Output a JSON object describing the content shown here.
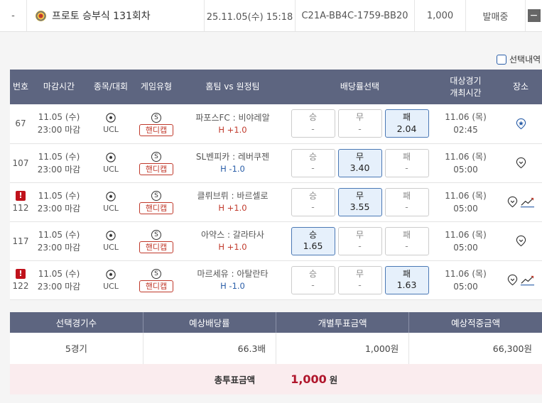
{
  "summary": {
    "dash": "-",
    "title": "프로토 승부식 131회차",
    "date": "25.11.05(수) 15:18",
    "code": "C21A-BB4C-1759-BB20",
    "amount": "1,000",
    "status": "발매중",
    "collapse": "−"
  },
  "select_label": "선택내역",
  "headers": {
    "no": "번호",
    "deadline": "마감시간",
    "sport": "종목/대회",
    "gtype": "게임유형",
    "teams": "홈팀 vs 원정팀",
    "odds": "배당률선택",
    "match_time_1": "대상경기",
    "match_time_2": "개최시간",
    "venue": "장소"
  },
  "games": [
    {
      "no": "67",
      "alert": false,
      "deadline_date": "11.05 (수)",
      "deadline_time": "23:00 마감",
      "league": "UCL",
      "gtype_s": "S",
      "gtype_badge": "핸디캡",
      "teams": "파포스FC : 비야레알",
      "handi": "H +1.0",
      "handi_sign": "plus",
      "odds": [
        {
          "label": "승",
          "value": "-",
          "selected": false
        },
        {
          "label": "무",
          "value": "-",
          "selected": false
        },
        {
          "label": "패",
          "value": "2.04",
          "selected": true
        }
      ],
      "match_date": "11.06 (목)",
      "match_time": "02:45",
      "venue_icon": "star-location-icon",
      "stats": false
    },
    {
      "no": "107",
      "alert": false,
      "deadline_date": "11.05 (수)",
      "deadline_time": "23:00 마감",
      "league": "UCL",
      "gtype_s": "S",
      "gtype_badge": "핸디캡",
      "teams": "SL벤피카 : 레버쿠젠",
      "handi": "H -1.0",
      "handi_sign": "minus",
      "odds": [
        {
          "label": "승",
          "value": "-",
          "selected": false
        },
        {
          "label": "무",
          "value": "3.40",
          "selected": true
        },
        {
          "label": "패",
          "value": "-",
          "selected": false
        }
      ],
      "match_date": "11.06 (목)",
      "match_time": "05:00",
      "venue_icon": "location-icon",
      "stats": false
    },
    {
      "no": "112",
      "alert": true,
      "alert_mark": "!",
      "deadline_date": "11.05 (수)",
      "deadline_time": "23:00 마감",
      "league": "UCL",
      "gtype_s": "S",
      "gtype_badge": "핸디캡",
      "teams": "클뤼브뤼 : 바르셀로",
      "handi": "H +1.0",
      "handi_sign": "plus",
      "odds": [
        {
          "label": "승",
          "value": "-",
          "selected": false
        },
        {
          "label": "무",
          "value": "3.55",
          "selected": true
        },
        {
          "label": "패",
          "value": "-",
          "selected": false
        }
      ],
      "match_date": "11.06 (목)",
      "match_time": "05:00",
      "venue_icon": "location-icon",
      "stats": true
    },
    {
      "no": "117",
      "alert": false,
      "deadline_date": "11.05 (수)",
      "deadline_time": "23:00 마감",
      "league": "UCL",
      "gtype_s": "S",
      "gtype_badge": "핸디캡",
      "teams": "아약스 : 갈라타사",
      "handi": "H +1.0",
      "handi_sign": "plus",
      "odds": [
        {
          "label": "승",
          "value": "1.65",
          "selected": true
        },
        {
          "label": "무",
          "value": "-",
          "selected": false
        },
        {
          "label": "패",
          "value": "-",
          "selected": false
        }
      ],
      "match_date": "11.06 (목)",
      "match_time": "05:00",
      "venue_icon": "location-icon",
      "stats": false
    },
    {
      "no": "122",
      "alert": true,
      "alert_mark": "!",
      "deadline_date": "11.05 (수)",
      "deadline_time": "23:00 마감",
      "league": "UCL",
      "gtype_s": "S",
      "gtype_badge": "핸디캡",
      "teams": "마르세유 : 아탈란타",
      "handi": "H -1.0",
      "handi_sign": "minus",
      "odds": [
        {
          "label": "승",
          "value": "-",
          "selected": false
        },
        {
          "label": "무",
          "value": "-",
          "selected": false
        },
        {
          "label": "패",
          "value": "1.63",
          "selected": true
        }
      ],
      "match_date": "11.06 (목)",
      "match_time": "05:00",
      "venue_icon": "location-icon",
      "stats": true
    }
  ],
  "summary_table": {
    "headers": [
      "선택경기수",
      "예상배당률",
      "개별투표금액",
      "예상적중금액"
    ],
    "values": [
      "5경기",
      "66.3배",
      "1,000원",
      "66,300원"
    ]
  },
  "total": {
    "label": "총투표금액",
    "amount": "1,000",
    "unit": "원"
  },
  "colors": {
    "header_bg": "#5d6580",
    "selected_bg": "#e6f0fb",
    "accent_red": "#b0162c",
    "handi_plus": "#c0392b",
    "handi_minus": "#2a5ea8"
  }
}
